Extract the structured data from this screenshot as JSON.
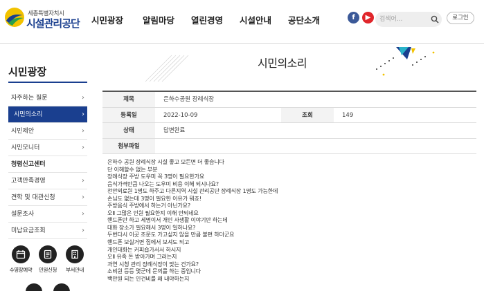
{
  "header": {
    "logo_small": "세종특별자치시",
    "logo_big": "시설관리공단",
    "nav": [
      "시민광장",
      "알림마당",
      "열린경영",
      "시설안내",
      "공단소개"
    ],
    "sns": {
      "facebook": "f",
      "youtube": "▶"
    },
    "search_placeholder": "검색어...",
    "login_label": "로그인"
  },
  "sidebar": {
    "title": "시민광장",
    "items": [
      {
        "label": "자주하는 질문",
        "active": false
      },
      {
        "label": "시민의소리",
        "active": true
      },
      {
        "label": "시민제안",
        "active": false
      },
      {
        "label": "시민모니터",
        "active": false
      },
      {
        "label": "청렴신고센터",
        "active": false
      },
      {
        "label": "고객만족경영",
        "active": false
      },
      {
        "label": "견학 및 대관신청",
        "active": false
      },
      {
        "label": "설문조사",
        "active": false
      },
      {
        "label": "미납요금조회",
        "active": false
      }
    ],
    "arrow": "›",
    "quick_links": [
      {
        "label": "수영장예약",
        "icon": "calendar-icon"
      },
      {
        "label": "민원신청",
        "icon": "document-icon"
      },
      {
        "label": "부서안내",
        "icon": "building-icon"
      }
    ]
  },
  "page": {
    "title": "시민의소리"
  },
  "board": {
    "subject_label": "제목",
    "subject": "은하수공원 장례식장",
    "date_label": "등록일",
    "date": "2022-10-09",
    "views_label": "조회",
    "views": "149",
    "status_label": "상태",
    "status": "답변완료",
    "attachment_label": "첨부파일",
    "attachment": ""
  },
  "body_lines": [
    "은하수 공원 장례식장 시설 좋고 모든면 더 좋습니다",
    "단 이해할수 없는 부분",
    "장례식장 주방 도우미 꼭 3명이 필요한가요",
    "음식가격만큼 나오는 도우미 비용 이해 되시나요?",
    "천안외료원 1명도 하주고 다른지역 시설 관리공단 장례식장 1명도 가능한데",
    "손님도 없는데 3명이 필요한 이유가 뭐죠!",
    "주방음식 주방에서 하는거 아닌가요?",
    "오Ⅱ 그많은 인원 필요한지 이해 안되네요",
    "핸드폰만 하고 세명이서 개인 사생활 이야기만 하는데",
    "대화 장소가 필요해서 3명이 일하나요?",
    "두번다시 이곳 조문도 가고싶지 않을 만큼 불편 하더군요",
    "핸드폰 보실거면 집에서 보셔도 되고",
    "개인대화는 커피숍가서서 하시지",
    "오Ⅱ 유족 돈 받아가며 그러는지",
    "과연 시청 관리 장례식장이 맞는 건가요?",
    "소비원 등등 몇군데 문의를 하는 중입니다",
    "백만원 되는 인건비를 왜 내야하는지"
  ],
  "colors": {
    "brand_blue": "#1a3f8f",
    "facebook": "#3b5998",
    "youtube": "#e0262b"
  }
}
